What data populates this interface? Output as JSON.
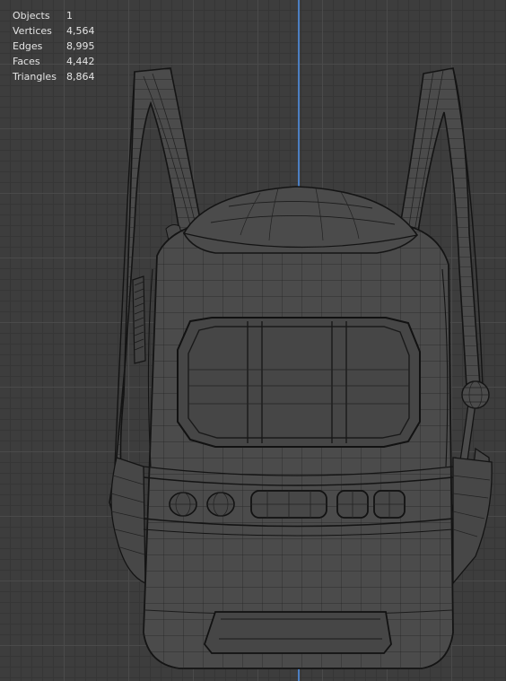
{
  "statistics": [
    {
      "label": "Objects",
      "value": "1"
    },
    {
      "label": "Vertices",
      "value": "4,564"
    },
    {
      "label": "Edges",
      "value": "8,995"
    },
    {
      "label": "Faces",
      "value": "4,442"
    },
    {
      "label": "Triangles",
      "value": "8,864"
    }
  ],
  "colors": {
    "background": "#3d3d3d",
    "grid": "#4a4a4a",
    "axis": "#4c7fc2",
    "mesh_fill": "#4b4b4b",
    "wire": "#161616"
  },
  "icons": [
    "backpack-wireframe-model"
  ]
}
